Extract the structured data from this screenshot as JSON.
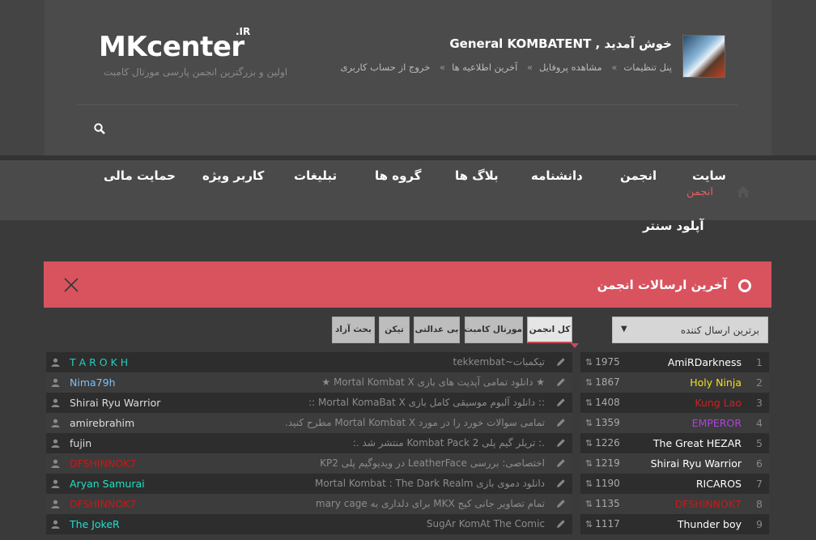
{
  "header": {
    "logo": "MKcenter",
    "logo_suffix": ".IR",
    "tagline": "اولین و بزرگترین انجمن پارسی مورتال کامبت",
    "welcome": "خوش آمدید , General KOMBATENT",
    "user_links": [
      "پنل تنظیمات",
      "مشاهده پروفایل",
      "آخرین اطلاعیه ها",
      "خروج از حساب کاربری"
    ]
  },
  "nav": {
    "items": [
      "سایت",
      "انجمن",
      "دانشنامه",
      "بلاگ ها",
      "گروه ها",
      "تبلیغات",
      "کاربر ویژه",
      "حمایت مالی"
    ],
    "sub": "انجمن",
    "upload": "آپلود سنتر"
  },
  "banner": {
    "title": "آخرین ارسالات انجمن"
  },
  "controls": {
    "sort_value": "برترین ارسال کننده",
    "tabs": [
      "کل انجمن",
      "مورتال کامبت",
      "بی عدالتی",
      "تیکن",
      "بحث آزاد"
    ]
  },
  "top_posters": [
    {
      "rank": "1",
      "name": "AmiRDarkness",
      "count": "1975",
      "color": "#ffffff"
    },
    {
      "rank": "2",
      "name": "Holy Ninja",
      "count": "1867",
      "color": "#f0e020"
    },
    {
      "rank": "3",
      "name": "Kung Lao",
      "count": "1408",
      "color": "#d02020"
    },
    {
      "rank": "4",
      "name": "EMPEROR",
      "count": "1359",
      "color": "#b040e0"
    },
    {
      "rank": "5",
      "name": "The Great HEZAR",
      "count": "1226",
      "color": "#ffffff"
    },
    {
      "rank": "6",
      "name": "Shirai Ryu Warrior",
      "count": "1219",
      "color": "#ffffff"
    },
    {
      "rank": "7",
      "name": "RICAROS",
      "count": "1190",
      "color": "#ffffff"
    },
    {
      "rank": "8",
      "name": "DFSHINNOK7",
      "count": "1135",
      "color": "#c81818"
    },
    {
      "rank": "9",
      "name": "Thunder boy",
      "count": "1117",
      "color": "#ffffff"
    }
  ],
  "latest_posts": [
    {
      "title": "تیکمبات~tekkembat",
      "user": "T A R O K H",
      "color": "#20d0c0"
    },
    {
      "title": "★ دانلود تمامی آپدیت های بازی Mortal Kombat X ★",
      "user": "Nima79h",
      "color": "#7ec0f0"
    },
    {
      "title": ":: دانلود آلبوم موسیقی کامل بازی Mortal KomaBat X ::",
      "user": "Shirai Ryu Warrior",
      "color": "#dddddd"
    },
    {
      "title": "تمامی سوالات خورد را در مورد Mortal Kombat X مطرح کنید.",
      "user": "amirebrahim",
      "color": "#dddddd"
    },
    {
      "title": ".: تریلر گیم پلی Kombat Pack 2 منتشر شد .:",
      "user": "fujin",
      "color": "#dddddd"
    },
    {
      "title": "اختصاصی: بررسی LeatherFace در ویدیوگیم پلی KP2",
      "user": "DFSHINNOK7",
      "color": "#c81818"
    },
    {
      "title": "دانلود دموی بازی Mortal Kombat : The Dark Realm",
      "user": "Aryan Samurai",
      "color": "#20e0c0"
    },
    {
      "title": "تمام تصاویر جانی کیج MKX برای دلداری به mary cage",
      "user": "DFSHINNOK7",
      "color": "#c81818"
    },
    {
      "title": "SugAr KomAt The Comic",
      "user": "The JokeR",
      "color": "#20e0d0"
    }
  ]
}
